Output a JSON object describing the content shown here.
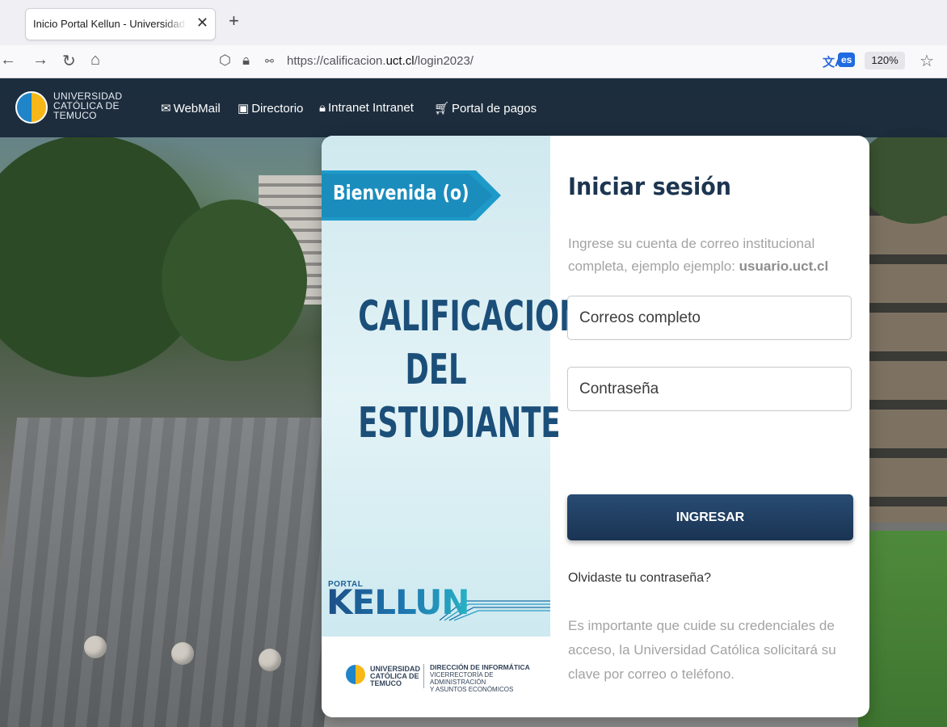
{
  "browser": {
    "tab_title": "Inicio Portal Kellun - Universidad Católica de Temuco",
    "url_plain_before": "https://calificacion.",
    "url_domain": "uct.cl",
    "url_plain_after": "/login2023/",
    "language_badge": "es",
    "zoom": "120%",
    "icons": [
      "back-icon",
      "forward-icon",
      "reload-icon",
      "home-icon",
      "shield-icon",
      "lock-icon",
      "permissions-icon",
      "translate-icon",
      "bookmark-star-icon"
    ]
  },
  "header": {
    "logo_line1": "UNIVERSIDAD",
    "logo_line2": "CATÓLICA DE",
    "logo_line3": "TEMUCO",
    "nav": [
      {
        "label": "WebMail",
        "icon": "envelope-icon"
      },
      {
        "label": "Directorio",
        "icon": "contact-card-icon"
      },
      {
        "label": "Intranet Intranet",
        "icon": "lock-icon"
      },
      {
        "label": "Portal de pagos",
        "icon": "cart-icon"
      }
    ]
  },
  "banner": {
    "welcome": "Bienvenida (o)",
    "title_line1": "CALIFICACION",
    "title_line2": "DEL",
    "title_line3": "ESTUDIANTE",
    "brand_small": "PORTAL",
    "brand": "KELLUN",
    "footer_uni1": "UNIVERSIDAD",
    "footer_uni2": "CATÓLICA DE",
    "footer_uni3": "TEMUCO",
    "footer_dir1": "DIRECCIÓN DE INFORMÁTICA",
    "footer_dir2": "VICERRECTORÍA DE ADMINISTRACIÓN",
    "footer_dir3": "Y ASUNTOS ECONÓMICOS"
  },
  "login": {
    "title": "Iniciar sesión",
    "hint_prefix": "Ingrese su cuenta de correo institucional completa, ejemplo ejemplo: ",
    "hint_example": "usuario.uct.cl",
    "email_placeholder": "Correos completo",
    "password_placeholder": "Contraseña",
    "submit_label": "INGRESAR",
    "forgot_label": "Olvidaste tu contraseña?",
    "notice": "Es importante que cuide su credenciales de acceso, la Universidad Católica solicitará su clave por correo o teléfono."
  },
  "colors": {
    "header_bg": "#1a2a3a",
    "title_blue": "#1b4f79",
    "welcome_tag": "#1b8dbd",
    "button_bg": "#1f3c60"
  }
}
